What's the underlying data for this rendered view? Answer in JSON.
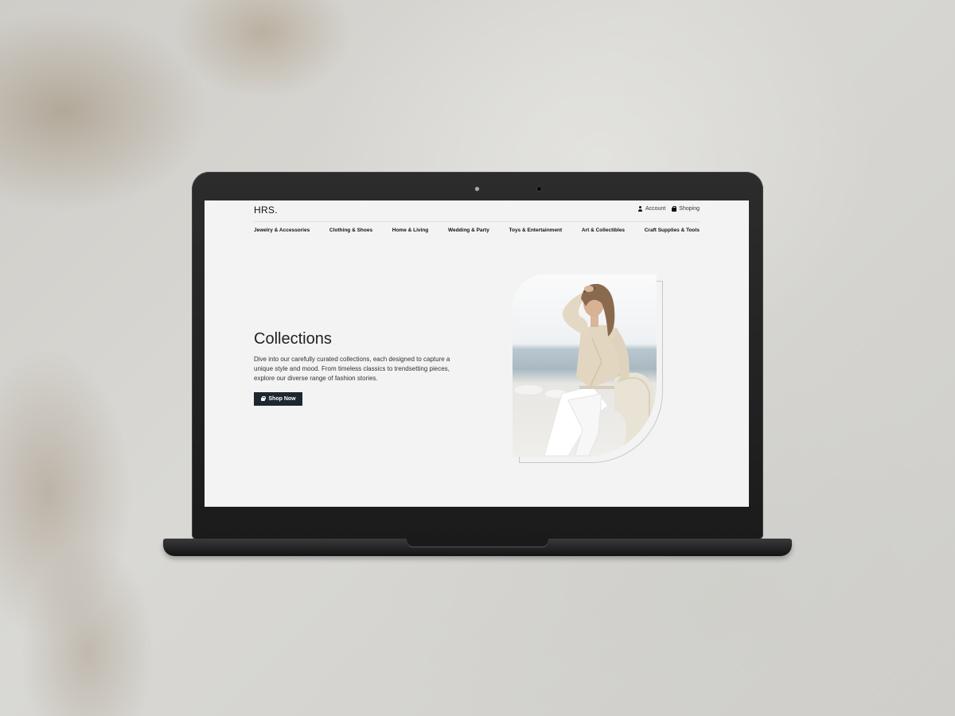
{
  "site": {
    "logo": "HRS.",
    "account_label": "Account",
    "shopping_label": "Shoping"
  },
  "nav": {
    "items": [
      {
        "label": "Jewelry & Accessories"
      },
      {
        "label": "Clothing & Shoes"
      },
      {
        "label": "Home & Living"
      },
      {
        "label": "Wedding & Party"
      },
      {
        "label": "Toys & Entertainment"
      },
      {
        "label": "Art & Collectibles"
      },
      {
        "label": "Craft Supplies & Tools"
      }
    ]
  },
  "hero": {
    "title": "Collections",
    "description": "Dive into our carefully curated collections, each designed to capture a unique style and mood. From timeless classics to trendsetting pieces, explore our diverse range of fashion stories.",
    "button_label": "Shop Now"
  },
  "icons": {
    "account": "user-icon",
    "shopping": "shopping-bag-icon",
    "button": "shopping-bag-icon"
  },
  "colors": {
    "button_bg": "#1e2730",
    "screen_bg": "#f3f3f3",
    "laptop": "#1f1f1f"
  }
}
